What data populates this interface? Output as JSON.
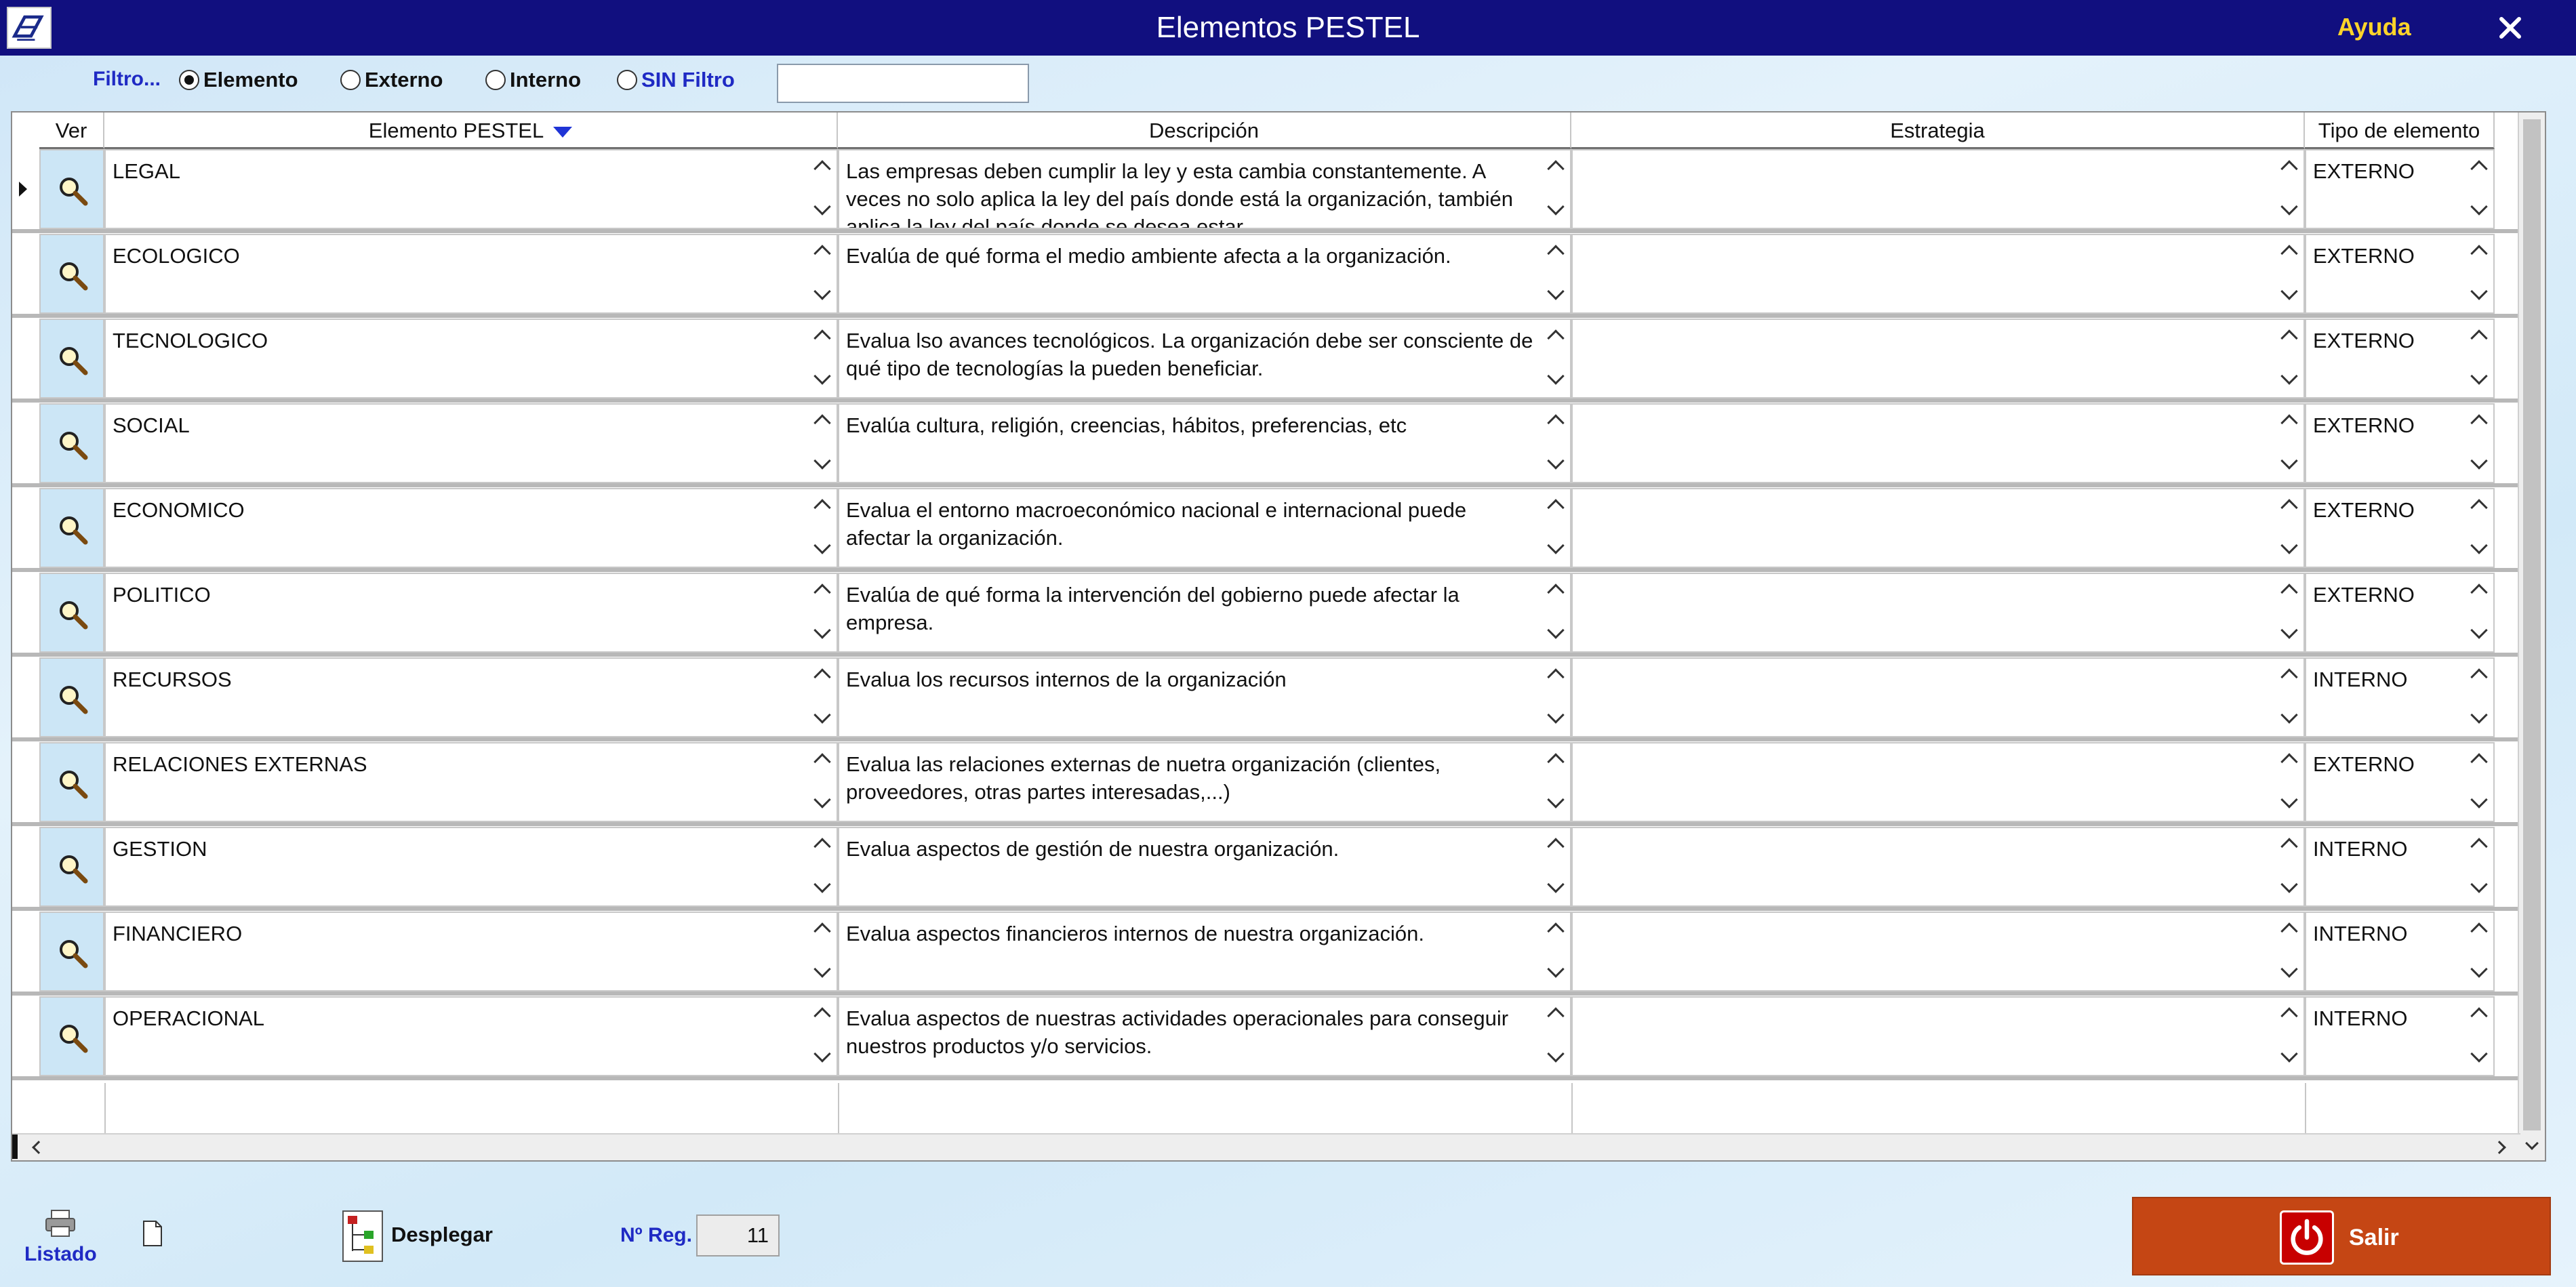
{
  "window": {
    "title": "Elementos PESTEL",
    "help_label": "Ayuda",
    "close_glyph": "✕"
  },
  "filter": {
    "label": "Filtro...",
    "options": [
      {
        "label": "Elemento",
        "selected": true
      },
      {
        "label": "Externo",
        "selected": false
      },
      {
        "label": "Interno",
        "selected": false
      },
      {
        "label": "SIN Filtro",
        "selected": false
      }
    ],
    "search_value": ""
  },
  "grid": {
    "columns": [
      "Ver",
      "Elemento PESTEL",
      "Descripción",
      "Estrategia",
      "Tipo de elemento"
    ],
    "sort_column": "Elemento PESTEL",
    "rows": [
      {
        "elemento": "LEGAL",
        "descripcion": "Las empresas deben cumplir la ley y esta cambia constantemente. A veces no solo aplica la ley del país donde está la organización, también aplica la ley del país donde se desea estar.",
        "estrategia": "",
        "tipo": "EXTERNO",
        "current": true
      },
      {
        "elemento": "ECOLOGICO",
        "descripcion": "Evalúa de qué forma el medio ambiente afecta a la organización.",
        "estrategia": "",
        "tipo": "EXTERNO"
      },
      {
        "elemento": "TECNOLOGICO",
        "descripcion": "Evalua lso avances tecnológicos. La organización debe ser consciente de qué tipo de tecnologías la pueden beneficiar.",
        "estrategia": "",
        "tipo": "EXTERNO"
      },
      {
        "elemento": "SOCIAL",
        "descripcion": "Evalúa cultura, religión, creencias, hábitos, preferencias, etc",
        "estrategia": "",
        "tipo": "EXTERNO"
      },
      {
        "elemento": "ECONOMICO",
        "descripcion": "Evalua el entorno macroeconómico nacional e internacional puede afectar la organización.",
        "estrategia": "",
        "tipo": "EXTERNO"
      },
      {
        "elemento": "POLITICO",
        "descripcion": "Evalúa de qué forma la intervención del gobierno puede afectar la empresa.",
        "estrategia": "",
        "tipo": "EXTERNO"
      },
      {
        "elemento": "RECURSOS",
        "descripcion": "Evalua los recursos internos de la organización",
        "estrategia": "",
        "tipo": "INTERNO"
      },
      {
        "elemento": "RELACIONES EXTERNAS",
        "descripcion": "Evalua las relaciones externas de nuetra organización (clientes, proveedores, otras partes interesadas,...)",
        "estrategia": "",
        "tipo": "EXTERNO"
      },
      {
        "elemento": "GESTION",
        "descripcion": "Evalua aspectos de gestión de nuestra organización.",
        "estrategia": "",
        "tipo": "INTERNO"
      },
      {
        "elemento": "FINANCIERO",
        "descripcion": "Evalua aspectos financieros internos de nuestra organización.",
        "estrategia": "",
        "tipo": "INTERNO"
      },
      {
        "elemento": "OPERACIONAL",
        "descripcion": "Evalua aspectos de nuestras actividades operacionales para conseguir nuestros productos y/o servicios.",
        "estrategia": "",
        "tipo": "INTERNO"
      }
    ]
  },
  "footer": {
    "listado_label": "Listado",
    "desplegar_label": "Desplegar",
    "nreg_label": "Nº Reg.",
    "nreg_value": "11",
    "salir_label": "Salir"
  },
  "colors": {
    "titlebar": "#110f7f",
    "help": "#ffd42a",
    "accent_blue": "#1f2ac4",
    "ver_cell": "#cce6f6",
    "salir_button": "#c54614"
  },
  "icons": [
    "app-logo-icon",
    "close-icon",
    "magnifier-icon",
    "printer-icon",
    "document-icon",
    "tree-icon",
    "power-icon"
  ]
}
